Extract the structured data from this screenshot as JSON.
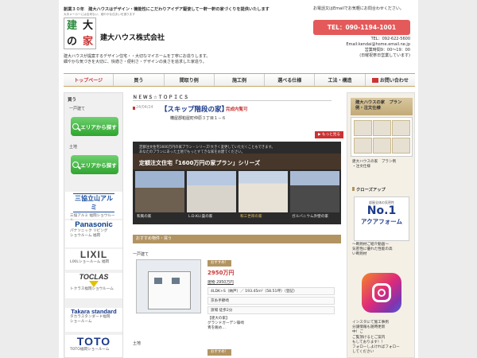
{
  "header": {
    "tagline": "創業３０年　建大ハウスはデザイン・機能性にこだわりアイデア駆使して一軒一軒の家づくりを提供いたします",
    "logo_small": "大手メーカーには出来ない、細やかな住まいを造ります",
    "logo_chars": [
      "建",
      "大",
      "の",
      "家"
    ],
    "company": "建大ハウス株式会社",
    "desc_lines": [
      "建大ハウスが提案するデザイン住宅・・大切なマイホームを丁寧にお造りします。",
      "細やかな気づきを大切に、快適さ・便利さ・デザインの良さを追求した家造り。"
    ],
    "contact_note": "お電話又はEmailでお気軽にお問合わせください。",
    "tel_button": "TEL：090-1194-1001",
    "tel_lines": [
      "TEL：092-622-5600",
      "Email:kendai@home.email.ne.jp",
      "営業時間9：00～19：00",
      "(日曜祝祭日営業しています)"
    ]
  },
  "nav": [
    {
      "label": "トップページ",
      "active": true
    },
    {
      "label": "買う",
      "active": false
    },
    {
      "label": "間取り例",
      "active": false
    },
    {
      "label": "施工例",
      "active": false
    },
    {
      "label": "選べる仕様",
      "active": false
    },
    {
      "label": "工法・構造",
      "active": false
    },
    {
      "label": "お問い合わせ",
      "active": false
    }
  ],
  "left": {
    "heading": "買う",
    "sub1": "一戸建て",
    "area_button": "エリアから探す",
    "sub2": "土地",
    "brands": [
      {
        "logo": "三協立山アルミ",
        "caption": [
          "三協アルミ 福岡ショウルー",
          "ム"
        ]
      },
      {
        "logo": "Panasonic",
        "caption": [
          "パナソニック リビング",
          "ショウルーム 福岡"
        ]
      },
      {
        "logo": "LIXIL",
        "caption": [
          "LIXILショールーム 福岡"
        ]
      },
      {
        "logo": "TOCLAS",
        "caption": [
          "トクラス福岡ショウルーム"
        ]
      },
      {
        "logo": "Takara standard",
        "caption": [
          "タカラスタンダード福岡",
          "ショールーム"
        ]
      },
      {
        "logo": "TOTO",
        "caption": [
          "TOTO福岡ショールーム"
        ]
      }
    ]
  },
  "news": {
    "heading": "ＮＥＷＳ☆ＴＯＰＩＣＳ",
    "date": "24/04/24",
    "title": "【スキップ階段の家】",
    "badge": "完成内覧可",
    "location": "糟屋郡粕屋町仲原３丁目１－６",
    "more": "▶ もっと見る"
  },
  "banner": {
    "sub_lines": [
      "定額注文住宅1600万円の家プラン・シリーズ!大きく変更していただくこともできます。",
      "あなたのプランにあった土地でもっとすてきな家をお建てください。"
    ],
    "title": "定額注文住宅「1600万円の家プラン」シリーズ",
    "captions": [
      "和風の家",
      "L.D.Kに畳の家",
      "和三世帯の家",
      "ガルバニウム外壁の家"
    ]
  },
  "listing": {
    "section_title": "おすすめ物件・買う",
    "cat1": "一戸建て",
    "badge": "おすすめ！",
    "price": "2950万円",
    "land": "建物 2950万円",
    "rows": [
      "4LDK+S（納戸）／ 193.45m²（58.51坪）（登記）",
      "京糸手節崎",
      "渡場 徒歩2分"
    ],
    "more_lines": [
      "【建大の家】",
      "グランドガーデン篠崎",
      "青を眺め…"
    ],
    "cat2": "土地",
    "badge2": "おすすめ！"
  },
  "right": {
    "head1": [
      "建大ハウスの家　プラン",
      "例・注文仕様"
    ],
    "caption1": [
      "建大ハウスの家　プラン例",
      "・注文仕様"
    ],
    "closeup": "クローズアップ",
    "aqua_top": "部屋全体の気密性",
    "aqua_no1": "No.1",
    "aqua_brand": "アクアフォーム",
    "aqua_caption": [
      "～断熱材ご紹介動画～",
      "気密性に優れた性能の高",
      "い断熱材"
    ],
    "insta_caption": [
      "インスタにて施工事例",
      "分譲情報も随時更新",
      "中！ご",
      "ご覧頂けるとご案内",
      "もしております！！",
      "フォローしよければフォロー",
      "してください"
    ]
  },
  "colors": {
    "accent": "#e45a5a",
    "brand_green": "#2fa52f",
    "gold": "#b29462"
  }
}
